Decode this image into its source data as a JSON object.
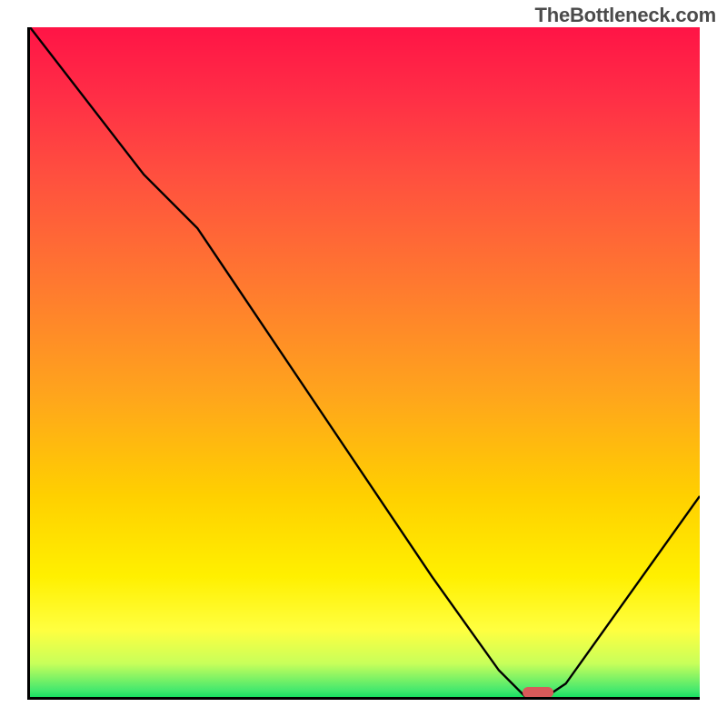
{
  "watermark": "TheBottleneck.com",
  "chart_data": {
    "type": "line",
    "title": "",
    "xlabel": "",
    "ylabel": "",
    "xlim": [
      0,
      100
    ],
    "ylim": [
      0,
      100
    ],
    "series": [
      {
        "name": "curve",
        "x": [
          0,
          17,
          25,
          60,
          70,
          74,
          77,
          80,
          100
        ],
        "values": [
          100,
          78,
          70,
          18,
          4,
          0,
          0,
          2,
          30
        ]
      }
    ],
    "min_marker": {
      "x": 75.5,
      "y": 0,
      "width_pct": 4.6
    },
    "background_gradient_stops": [
      {
        "pct": 0,
        "color": "#ff1446"
      },
      {
        "pct": 10,
        "color": "#ff2d46"
      },
      {
        "pct": 22,
        "color": "#ff4f3f"
      },
      {
        "pct": 38,
        "color": "#ff7830"
      },
      {
        "pct": 55,
        "color": "#ffa51c"
      },
      {
        "pct": 70,
        "color": "#ffd000"
      },
      {
        "pct": 82,
        "color": "#fff000"
      },
      {
        "pct": 90,
        "color": "#ffff40"
      },
      {
        "pct": 95,
        "color": "#c8ff5a"
      },
      {
        "pct": 99,
        "color": "#44e86e"
      },
      {
        "pct": 100,
        "color": "#18df62"
      }
    ]
  }
}
